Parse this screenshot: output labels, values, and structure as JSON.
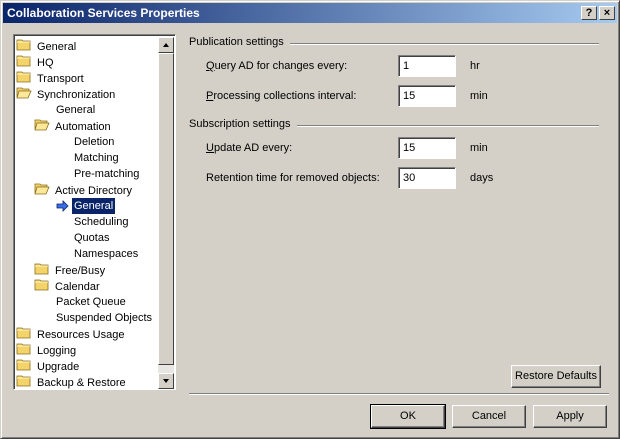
{
  "window": {
    "title": "Collaboration Services Properties",
    "help_label": "?",
    "close_label": "×"
  },
  "tree": {
    "items": [
      {
        "label": "General",
        "icon": "folder-icon"
      },
      {
        "label": "HQ",
        "icon": "folder-icon"
      },
      {
        "label": "Transport",
        "icon": "folder-icon"
      },
      {
        "label": "Synchronization",
        "icon": "folder-open-icon"
      },
      {
        "label": "General",
        "icon": ""
      },
      {
        "label": "Automation",
        "icon": "folder-open-icon"
      },
      {
        "label": "Deletion",
        "icon": ""
      },
      {
        "label": "Matching",
        "icon": ""
      },
      {
        "label": "Pre-matching",
        "icon": ""
      },
      {
        "label": "Active Directory",
        "icon": "folder-open-icon"
      },
      {
        "label": "General",
        "icon": "arrow-right-icon",
        "selected": true
      },
      {
        "label": "Scheduling",
        "icon": ""
      },
      {
        "label": "Quotas",
        "icon": ""
      },
      {
        "label": "Namespaces",
        "icon": ""
      },
      {
        "label": "Free/Busy",
        "icon": "folder-icon"
      },
      {
        "label": "Calendar",
        "icon": "folder-icon"
      },
      {
        "label": "Packet Queue",
        "icon": ""
      },
      {
        "label": "Suspended Objects",
        "icon": ""
      },
      {
        "label": "Resources Usage",
        "icon": "folder-icon"
      },
      {
        "label": "Logging",
        "icon": "folder-icon"
      },
      {
        "label": "Upgrade",
        "icon": "folder-icon"
      },
      {
        "label": "Backup & Restore",
        "icon": "folder-icon"
      }
    ]
  },
  "publication": {
    "title": "Publication settings",
    "query_label": "Query AD for changes every:",
    "query_value": "1",
    "query_unit": "hr",
    "processing_label": "Processing collections interval:",
    "processing_value": "15",
    "processing_unit": "min"
  },
  "subscription": {
    "title": "Subscription settings",
    "update_label": "Update AD every:",
    "update_value": "15",
    "update_unit": "min",
    "retention_label": "Retention time for removed objects:",
    "retention_value": "30",
    "retention_unit": "days"
  },
  "buttons": {
    "restore_defaults": "Restore Defaults",
    "ok": "OK",
    "cancel": "Cancel",
    "apply": "Apply"
  },
  "colors": {
    "title_start": "#0a246a",
    "title_end": "#a6caf0",
    "face": "#d4d0c8",
    "folder": "#f4d46a"
  }
}
